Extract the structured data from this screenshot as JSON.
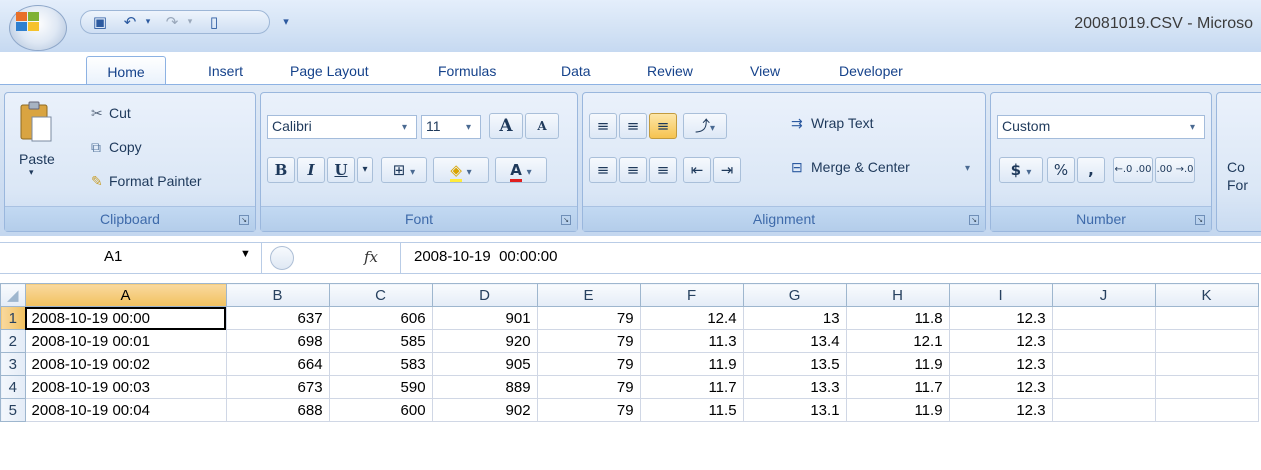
{
  "title": "20081019.CSV - Microso",
  "tabs": [
    "Home",
    "Insert",
    "Page Layout",
    "Formulas",
    "Data",
    "Review",
    "View",
    "Developer"
  ],
  "active_tab": "Home",
  "clipboard": {
    "paste": "Paste",
    "cut": "Cut",
    "copy": "Copy",
    "format_painter": "Format Painter",
    "label": "Clipboard"
  },
  "font": {
    "name": "Calibri",
    "size": "11",
    "label": "Font",
    "bold": "B",
    "italic": "I",
    "underline": "U",
    "grow": "A",
    "shrink": "A",
    "color_letter": "A"
  },
  "alignment": {
    "wrap": "Wrap Text",
    "merge": "Merge & Center",
    "label": "Alignment"
  },
  "number": {
    "format": "Custom",
    "currency": "$",
    "percent": "%",
    "comma": ",",
    "inc": "←.0 .00",
    "dec": ".00 →.0",
    "label": "Number"
  },
  "cond_format": {
    "line1": "Co",
    "line2": "For"
  },
  "name_box": "A1",
  "formula": "2008-10-19  00:00:00",
  "fx": "fx",
  "columns": [
    "A",
    "B",
    "C",
    "D",
    "E",
    "F",
    "G",
    "H",
    "I",
    "J",
    "K"
  ],
  "rows": [
    {
      "n": "1",
      "cells": [
        "2008-10-19 00:00",
        "637",
        "606",
        "901",
        "79",
        "12.4",
        "13",
        "11.8",
        "12.3",
        "",
        ""
      ]
    },
    {
      "n": "2",
      "cells": [
        "2008-10-19 00:01",
        "698",
        "585",
        "920",
        "79",
        "11.3",
        "13.4",
        "12.1",
        "12.3",
        "",
        ""
      ]
    },
    {
      "n": "3",
      "cells": [
        "2008-10-19 00:02",
        "664",
        "583",
        "905",
        "79",
        "11.9",
        "13.5",
        "11.9",
        "12.3",
        "",
        ""
      ]
    },
    {
      "n": "4",
      "cells": [
        "2008-10-19 00:03",
        "673",
        "590",
        "889",
        "79",
        "11.7",
        "13.3",
        "11.7",
        "12.3",
        "",
        ""
      ]
    },
    {
      "n": "5",
      "cells": [
        "2008-10-19 00:04",
        "688",
        "600",
        "902",
        "79",
        "11.5",
        "13.1",
        "11.9",
        "12.3",
        "",
        ""
      ]
    }
  ],
  "colors": {
    "accent": "#15428b",
    "selected_header": "#f1c15f",
    "ribbon": "#d3e1f3"
  }
}
